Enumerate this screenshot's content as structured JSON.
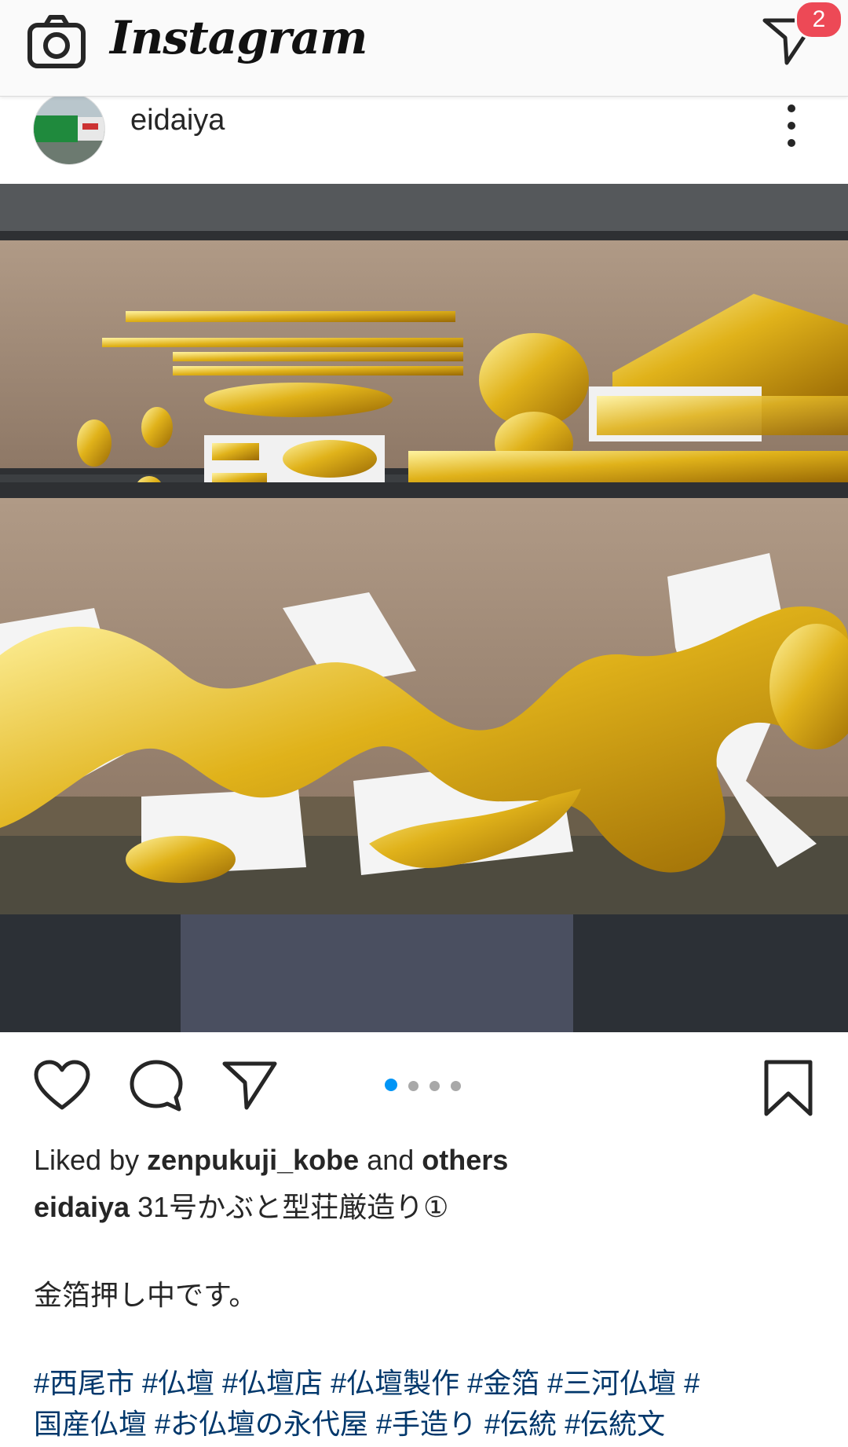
{
  "app": {
    "logo": "Instagram",
    "dm_badge_count": "2",
    "accent_color": "#0095f6",
    "badge_color": "#ed4956"
  },
  "post": {
    "username": "eidaiya",
    "carousel": {
      "total": 4,
      "active_index": 1
    },
    "likes": {
      "prefix": "Liked by",
      "user": "zenpukuji_kobe",
      "joiner": "and",
      "others": "others"
    },
    "caption": {
      "username": "eidaiya",
      "title": "31号かぶと型荘厳造り①",
      "body": "金箔押し中です。",
      "hashtags_line1": "#西尾市 #仏壇 #仏壇店 #仏壇製作 #金箔  #三河仏壇 #",
      "hashtags_line2": "国産仏壇 #お仏壇の永代屋 #手造り #伝統 #伝統文"
    }
  }
}
